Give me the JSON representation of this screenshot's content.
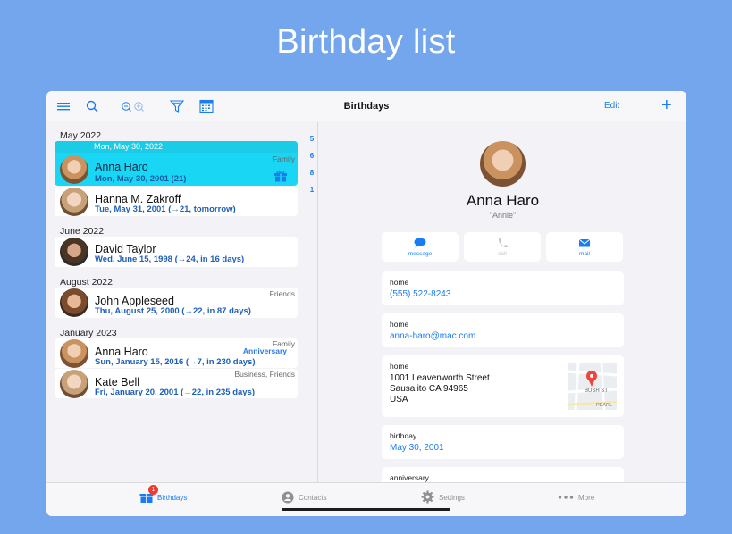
{
  "hero_title": "Birthday list",
  "navbar": {
    "title": "Birthdays",
    "edit_label": "Edit",
    "add_label": "+",
    "icons": [
      "menu-icon",
      "search-icon",
      "zoom-icon",
      "filter-icon",
      "calendar-icon"
    ]
  },
  "list": {
    "sections": [
      {
        "header": "May 2022"
      },
      {
        "header": "June 2022"
      },
      {
        "header": "August 2022"
      },
      {
        "header": "January 2023"
      }
    ],
    "selected_date_bar": "Mon, May 30, 2022",
    "rows": [
      {
        "name": "Anna Haro",
        "sub": "Mon, May 30, 2001 (21)",
        "tag": "Family",
        "tag2": ""
      },
      {
        "name": "Hanna M. Zakroff",
        "sub": "Tue, May 31, 2001 (→21, tomorrow)",
        "tag": "",
        "tag2": ""
      },
      {
        "name": "David Taylor",
        "sub": "Wed, June 15, 1998 (→24, in 16 days)",
        "tag": "",
        "tag2": ""
      },
      {
        "name": "John Appleseed",
        "sub": "Thu, August 25, 2000 (→22, in 87 days)",
        "tag": "Friends",
        "tag2": ""
      },
      {
        "name": "Anna Haro",
        "sub": "Sun, January 15, 2016 (→7, in 230 days)",
        "tag": "Family",
        "tag2": "Anniversary"
      },
      {
        "name": "Kate Bell",
        "sub": "Fri, January 20, 2001 (→22, in 235 days)",
        "tag": "Business, Friends",
        "tag2": ""
      }
    ],
    "index": [
      "5",
      "6",
      "8",
      "1"
    ]
  },
  "detail": {
    "name": "Anna Haro",
    "nickname": "\"Annie\"",
    "actions": [
      {
        "label": "message",
        "icon": "message-icon",
        "enabled": true
      },
      {
        "label": "call",
        "icon": "phone-icon",
        "enabled": false
      },
      {
        "label": "mail",
        "icon": "mail-icon",
        "enabled": true
      }
    ],
    "phone": {
      "label": "home",
      "value": "(555) 522-8243"
    },
    "email": {
      "label": "home",
      "value": "anna-haro@mac.com"
    },
    "address": {
      "label": "home",
      "line1": "1001  Leavenworth Street",
      "line2": "Sausalito CA 94965",
      "line3": "USA",
      "map_text1": "BUSH ST",
      "map_text2": "PEARL"
    },
    "birthday": {
      "label": "birthday",
      "value": "May 30, 2001"
    },
    "anniversary": {
      "label": "anniversary"
    }
  },
  "tabbar": {
    "tabs": [
      {
        "label": "Birthdays",
        "icon": "gift-icon",
        "badge": "1",
        "active": true
      },
      {
        "label": "Contacts",
        "icon": "person-icon",
        "active": false
      },
      {
        "label": "Settings",
        "icon": "gear-icon",
        "active": false
      },
      {
        "label": "More",
        "icon": "more-icon",
        "active": false
      }
    ]
  },
  "colors": {
    "accent": "#1a7cf0",
    "background": "#74a6ee",
    "selected_row": "#19d6f4",
    "badge": "#f23b30"
  }
}
